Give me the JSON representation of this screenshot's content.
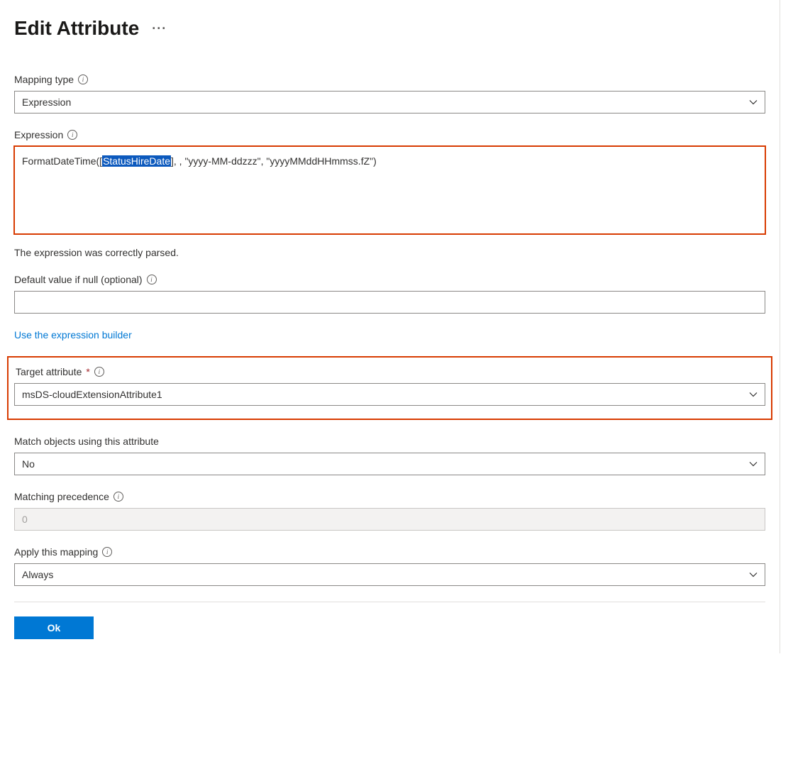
{
  "page": {
    "title": "Edit Attribute"
  },
  "fields": {
    "mappingType": {
      "label": "Mapping type",
      "value": "Expression"
    },
    "expression": {
      "label": "Expression",
      "value_prefix": "FormatDateTime([",
      "value_highlight": "StatusHireDate",
      "value_suffix": "], , \"yyyy-MM-ddzzz\", \"yyyyMMddHHmmss.fZ\")"
    },
    "status": "The expression was correctly parsed.",
    "defaultValue": {
      "label": "Default value if null (optional)",
      "value": ""
    },
    "builderLink": "Use the expression builder",
    "target": {
      "label": "Target attribute",
      "value": "msDS-cloudExtensionAttribute1"
    },
    "matchObjects": {
      "label": "Match objects using this attribute",
      "value": "No"
    },
    "matchingPrecedence": {
      "label": "Matching precedence",
      "value": "0"
    },
    "applyMapping": {
      "label": "Apply this mapping",
      "value": "Always"
    }
  },
  "buttons": {
    "ok": "Ok"
  }
}
